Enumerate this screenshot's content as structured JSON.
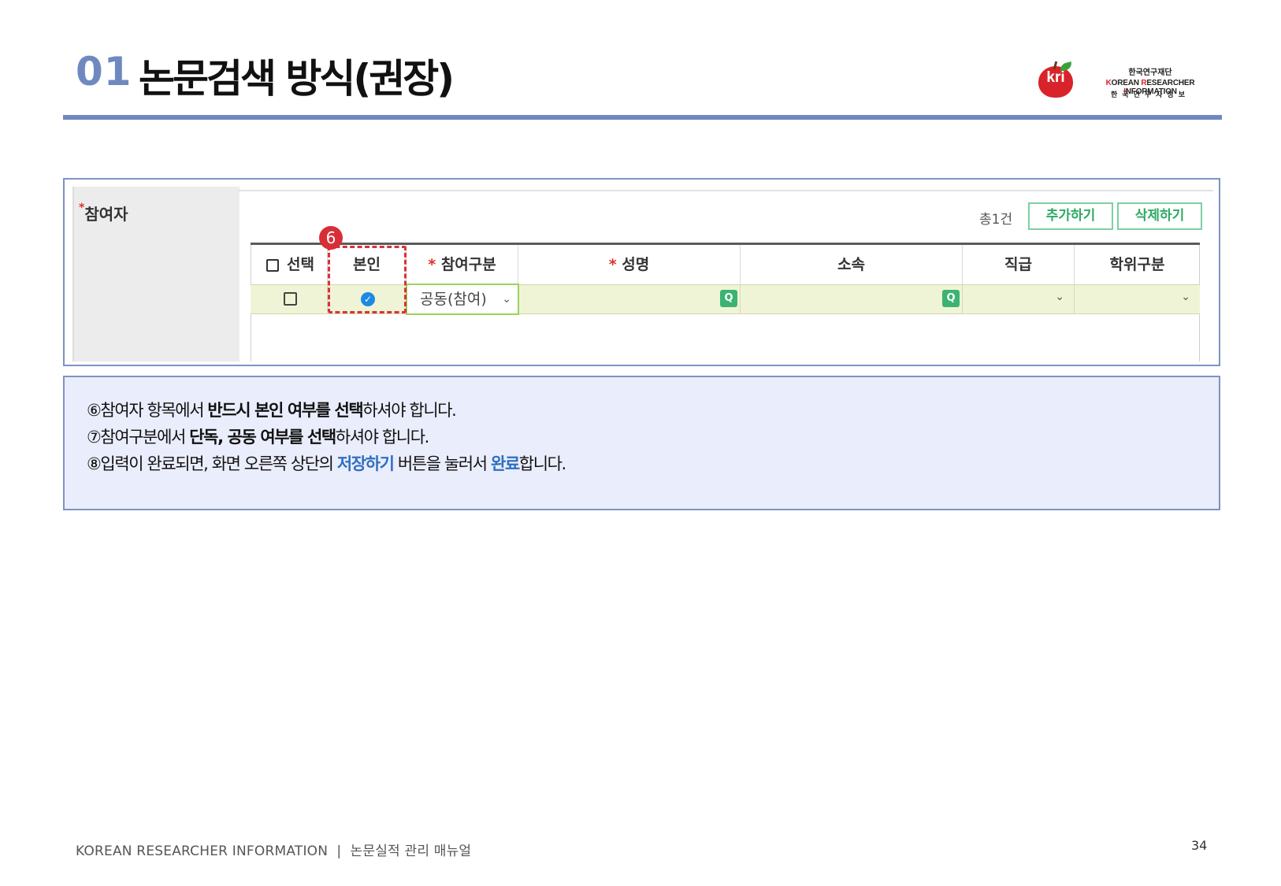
{
  "header": {
    "number": "01",
    "title": "논문검색 방식(권장)"
  },
  "logo": {
    "mark": "kri",
    "org_ko": "한국연구재단",
    "org_en_k": "K",
    "org_en_1": "OREAN ",
    "org_en_r": "R",
    "org_en_2": "ESEARCHER ",
    "org_en_i": "I",
    "org_en_3": "NFORMATION",
    "org_ko_spaced": "한국연구자정보"
  },
  "form": {
    "required_mark": "*",
    "section_label": "참여자",
    "total_count": "총1건",
    "add_button": "추가하기",
    "delete_button": "삭제하기",
    "columns": {
      "select": "선택",
      "self": "본인",
      "participation_type": "참여구분",
      "name": "성명",
      "affiliation": "소속",
      "position": "직급",
      "degree": "학위구분"
    },
    "row": {
      "participation_type_value": "공동(참여)"
    },
    "callout_number": "6"
  },
  "notes": {
    "line1": {
      "prefix": "⑥참여자 항목에서 ",
      "bold": "반드시 본인 여부를 선택",
      "suffix": "하셔야 합니다."
    },
    "line2": {
      "prefix": "⑦참여구분에서 ",
      "bold": "단독, 공동 여부를 선택",
      "suffix": "하셔야 합니다."
    },
    "line3": {
      "prefix": "⑧입력이 완료되면, 화면 오른쪽 상단의 ",
      "highlight1": "저장하기",
      "middle": " 버튼을 눌러서 ",
      "highlight2": "완료",
      "suffix": "합니다."
    }
  },
  "footer": {
    "left": "KOREAN RESEARCHER INFORMATION  |  논문실적 관리 매뉴얼",
    "page": "34"
  },
  "colors": {
    "accent": "#6f89c0",
    "required": "#e0302a",
    "button_green": "#2eaa63",
    "highlight_blue": "#2e6fc1",
    "callout_red": "#d82e36"
  }
}
